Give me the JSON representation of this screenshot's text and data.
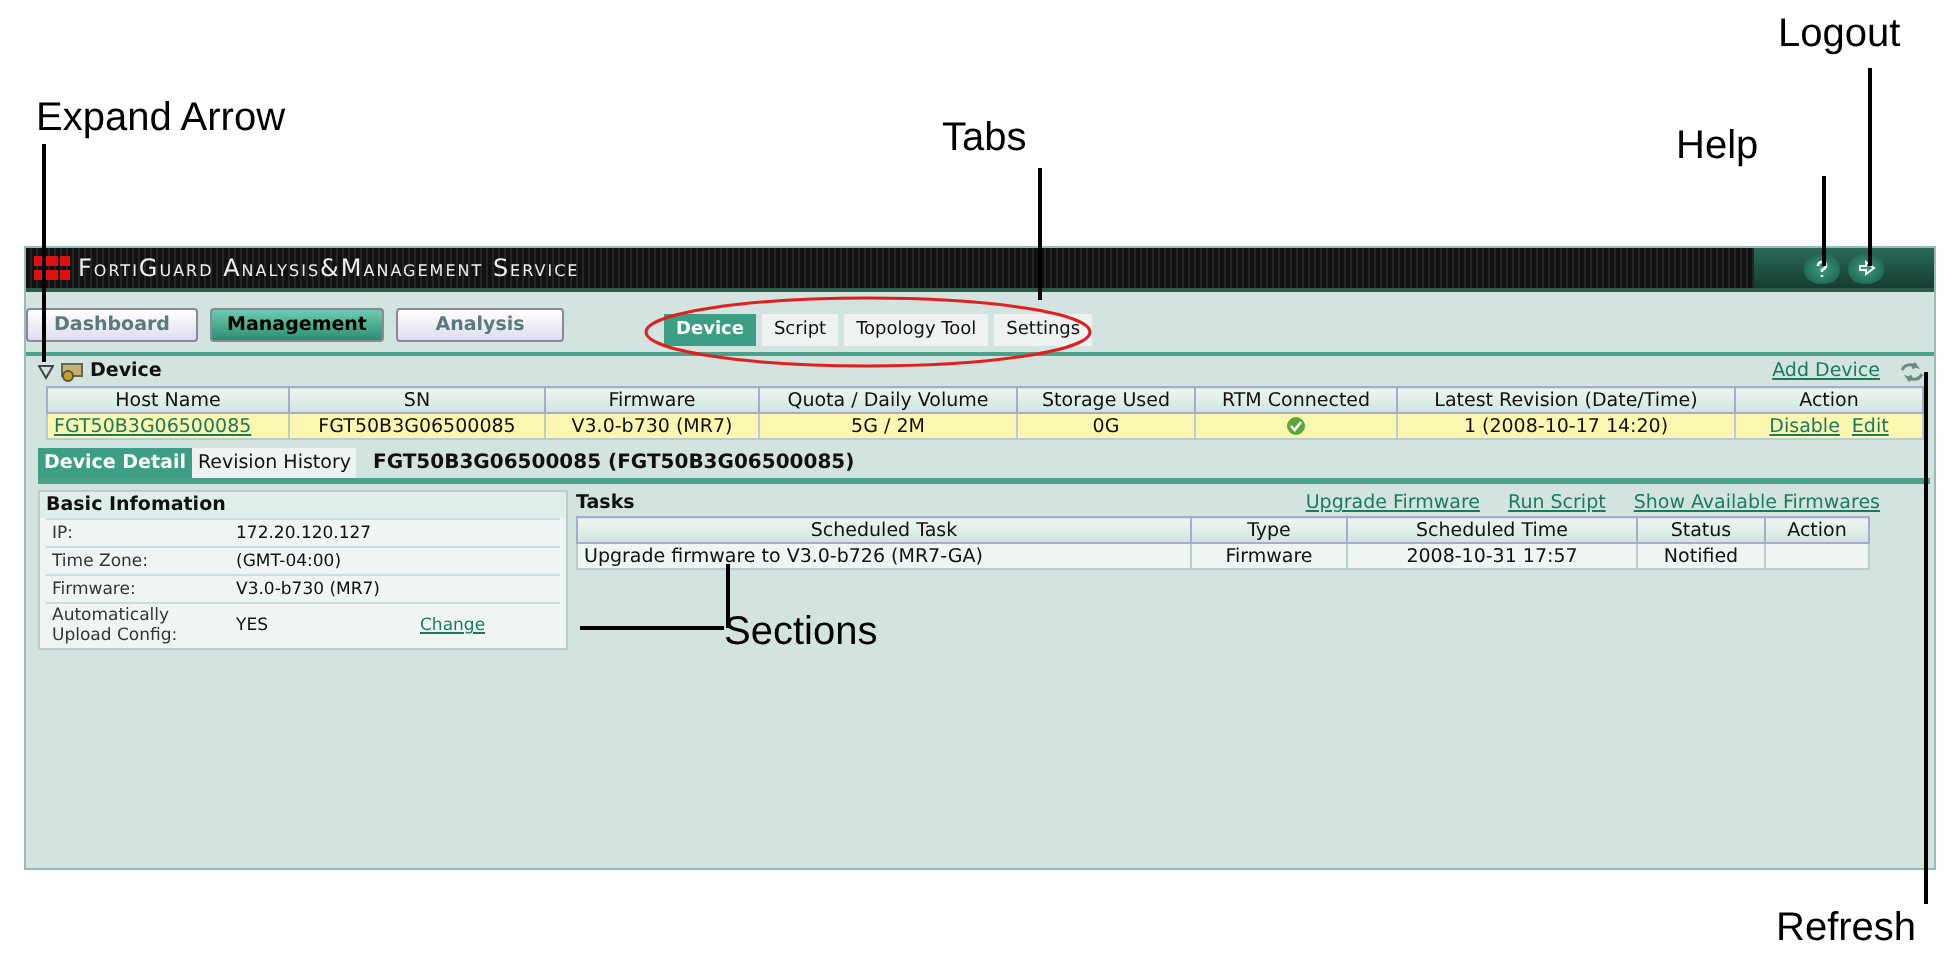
{
  "annotations": [
    {
      "text": "Logout"
    },
    {
      "text": "Expand Arrow"
    },
    {
      "text": "Tabs"
    },
    {
      "text": "Help"
    },
    {
      "text": "Sections"
    },
    {
      "text": "Refresh"
    }
  ],
  "window": {
    "title": "FortiGuard Analysis&Management Service"
  },
  "nav_buttons": [
    {
      "label": "Dashboard",
      "selected": false
    },
    {
      "label": "Management",
      "selected": true
    },
    {
      "label": "Analysis",
      "selected": false
    }
  ],
  "tabs": [
    {
      "label": "Device",
      "selected": true
    },
    {
      "label": "Script",
      "selected": false
    },
    {
      "label": "Topology Tool",
      "selected": false
    },
    {
      "label": "Settings",
      "selected": false
    }
  ],
  "device_section": {
    "title": "Device",
    "expanded": true,
    "add_link": "Add Device"
  },
  "device_table": {
    "columns": [
      "Host Name",
      "SN",
      "Firmware",
      "Quota / Daily Volume",
      "Storage Used",
      "RTM Connected",
      "Latest Revision (Date/Time)",
      "Action"
    ],
    "rows": [
      {
        "host_name": "FGT50B3G06500085",
        "sn": "FGT50B3G06500085",
        "firmware": "V3.0-b730 (MR7)",
        "quota": "5G / 2M",
        "storage": "0G",
        "rtm_connected": true,
        "latest_revision": "1 (2008-10-17 14:20)",
        "actions": [
          "Disable",
          "Edit"
        ]
      }
    ]
  },
  "detail_tabs": [
    {
      "label": "Device Detail",
      "selected": true
    },
    {
      "label": "Revision History",
      "selected": false
    }
  ],
  "detail_title": "FGT50B3G06500085 (FGT50B3G06500085)",
  "basic_info": {
    "title": "Basic Infomation",
    "rows": [
      {
        "label": "IP:",
        "value": "172.20.120.127"
      },
      {
        "label": "Time Zone:",
        "value": "(GMT-04:00)"
      },
      {
        "label": "Firmware:",
        "value": "V3.0-b730 (MR7)"
      },
      {
        "label": "Automatically Upload Config:",
        "value": "YES",
        "link": "Change"
      }
    ]
  },
  "tasks": {
    "title": "Tasks",
    "links": [
      "Upgrade Firmware",
      "Run Script",
      "Show Available Firmwares"
    ],
    "columns": [
      "Scheduled Task",
      "Type",
      "Scheduled Time",
      "Status",
      "Action"
    ],
    "rows": [
      {
        "task": "Upgrade firmware to V3.0-b726 (MR7-GA)",
        "type": "Firmware",
        "time": "2008-10-31 17:57",
        "status": "Notified"
      }
    ]
  }
}
